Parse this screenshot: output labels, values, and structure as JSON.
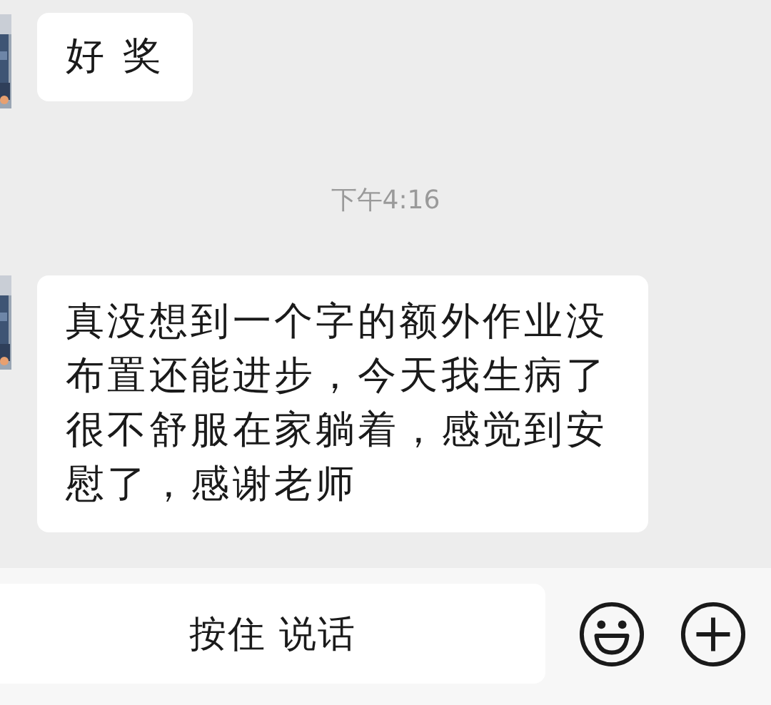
{
  "messages": [
    {
      "kind": "message",
      "text": "好 奖"
    },
    {
      "kind": "time",
      "text": "下午4:16"
    },
    {
      "kind": "message",
      "text": "真没想到一个字的额外作业没布置还能进步，今天我生病了很不舒服在家躺着，感觉到安慰了，感谢老师"
    }
  ],
  "input_bar": {
    "voice_button": "按住 说话"
  }
}
